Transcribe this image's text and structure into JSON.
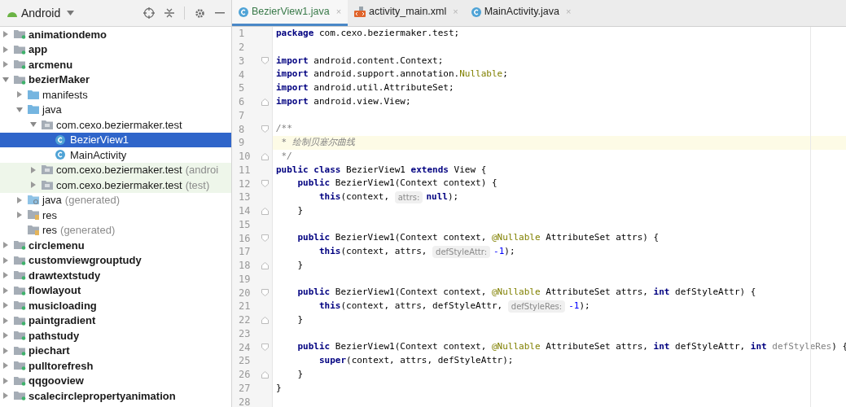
{
  "project_panel": {
    "title": "Android",
    "tree": [
      {
        "label": "animationdemo",
        "kind": "module",
        "expanded": false
      },
      {
        "label": "app",
        "kind": "module",
        "expanded": false
      },
      {
        "label": "arcmenu",
        "kind": "module",
        "expanded": false
      },
      {
        "label": "bezierMaker",
        "kind": "module",
        "expanded": true,
        "children": [
          {
            "label": "manifests",
            "kind": "folder",
            "expanded": false
          },
          {
            "label": "java",
            "kind": "folder",
            "expanded": true,
            "children": [
              {
                "label": "com.cexo.beziermaker.test",
                "kind": "package",
                "expanded": true,
                "children": [
                  {
                    "label": "BezierView1",
                    "kind": "class",
                    "selected": true
                  },
                  {
                    "label": "MainActivity",
                    "kind": "class",
                    "selected": false
                  }
                ]
              },
              {
                "label": "com.cexo.beziermaker.test",
                "suffix": "(androi",
                "kind": "package",
                "expanded": false,
                "tinted": true
              },
              {
                "label": "com.cexo.beziermaker.test",
                "suffix": "(test)",
                "kind": "package",
                "expanded": false,
                "tinted": true
              }
            ]
          },
          {
            "label": "java",
            "suffix": "(generated)",
            "kind": "generated",
            "expanded": false
          },
          {
            "label": "res",
            "kind": "res",
            "expanded": false
          },
          {
            "label": "res",
            "suffix": "(generated)",
            "kind": "res"
          }
        ]
      },
      {
        "label": "circlemenu",
        "kind": "module",
        "expanded": false
      },
      {
        "label": "customviewgrouptudy",
        "kind": "module",
        "expanded": false
      },
      {
        "label": "drawtextstudy",
        "kind": "module",
        "expanded": false
      },
      {
        "label": "flowlayout",
        "kind": "module",
        "expanded": false
      },
      {
        "label": "musicloading",
        "kind": "module",
        "expanded": false
      },
      {
        "label": "paintgradient",
        "kind": "module",
        "expanded": false
      },
      {
        "label": "pathstudy",
        "kind": "module",
        "expanded": false
      },
      {
        "label": "piechart",
        "kind": "module",
        "expanded": false
      },
      {
        "label": "pulltorefresh",
        "kind": "module",
        "expanded": false
      },
      {
        "label": "qqgooview",
        "kind": "module",
        "expanded": false
      },
      {
        "label": "scalecirclepropertyanimation",
        "kind": "module",
        "expanded": false
      }
    ]
  },
  "tabs": [
    {
      "label": "BezierView1.java",
      "kind": "class",
      "selected": true,
      "close": "×"
    },
    {
      "label": "activity_main.xml",
      "kind": "xml",
      "selected": false,
      "close": "×"
    },
    {
      "label": "MainActivity.java",
      "kind": "class",
      "selected": false,
      "close": "×"
    }
  ],
  "editor": {
    "lines": [
      {
        "number": "1",
        "fold_start": false,
        "fold_end": false,
        "current": false,
        "tokens": [
          {
            "kind": "kw",
            "text": "package"
          },
          {
            "kind": "plain",
            "text": " com.cexo.beziermaker.test;"
          }
        ]
      },
      {
        "number": "2",
        "fold_start": false,
        "fold_end": false,
        "current": false
      },
      {
        "number": "3",
        "fold_start": true,
        "fold_end": false,
        "current": false,
        "tokens": [
          {
            "kind": "kw",
            "text": "import"
          },
          {
            "kind": "plain",
            "text": " android.content.Context;"
          }
        ]
      },
      {
        "number": "4",
        "fold_start": false,
        "fold_end": false,
        "current": false,
        "tokens": [
          {
            "kind": "kw",
            "text": "import"
          },
          {
            "kind": "plain",
            "text": " android.support.annotation."
          },
          {
            "kind": "ann",
            "text": "Nullable"
          },
          {
            "kind": "plain",
            "text": ";"
          }
        ]
      },
      {
        "number": "5",
        "fold_start": false,
        "fold_end": false,
        "current": false,
        "tokens": [
          {
            "kind": "kw",
            "text": "import"
          },
          {
            "kind": "plain",
            "text": " android.util.AttributeSet;"
          }
        ]
      },
      {
        "number": "6",
        "fold_start": false,
        "fold_end": true,
        "current": false,
        "tokens": [
          {
            "kind": "kw",
            "text": "import"
          },
          {
            "kind": "plain",
            "text": " android.view.View;"
          }
        ]
      },
      {
        "number": "7",
        "fold_start": false,
        "fold_end": false,
        "current": false
      },
      {
        "number": "8",
        "fold_start": true,
        "fold_end": false,
        "current": false,
        "tokens": [
          {
            "kind": "comment",
            "text": "/**"
          }
        ]
      },
      {
        "number": "9",
        "fold_start": false,
        "fold_end": false,
        "current": true,
        "tokens": [
          {
            "kind": "comment",
            "text": " * 绘制贝塞尔曲线"
          }
        ]
      },
      {
        "number": "10",
        "fold_start": false,
        "fold_end": true,
        "current": false,
        "tokens": [
          {
            "kind": "comment",
            "text": " */"
          }
        ]
      },
      {
        "number": "11",
        "fold_start": false,
        "fold_end": false,
        "current": false,
        "tokens": [
          {
            "kind": "kw",
            "text": "public class"
          },
          {
            "kind": "plain",
            "text": " BezierView1 "
          },
          {
            "kind": "kw",
            "text": "extends"
          },
          {
            "kind": "plain",
            "text": " View {"
          }
        ]
      },
      {
        "number": "12",
        "fold_start": true,
        "fold_end": false,
        "current": false,
        "tokens": [
          {
            "kind": "kw",
            "text": "    public"
          },
          {
            "kind": "plain",
            "text": " BezierView1(Context context) {"
          }
        ]
      },
      {
        "number": "13",
        "fold_start": false,
        "fold_end": false,
        "current": false,
        "tokens": [
          {
            "kind": "kw",
            "text": "        this"
          },
          {
            "kind": "plain",
            "text": "(context, "
          },
          {
            "kind": "hint",
            "text": "attrs:"
          },
          {
            "kind": "kw",
            "text": "null"
          },
          {
            "kind": "plain",
            "text": ");"
          }
        ]
      },
      {
        "number": "14",
        "fold_start": false,
        "fold_end": true,
        "current": false,
        "tokens": [
          {
            "kind": "plain",
            "text": "    }"
          }
        ]
      },
      {
        "number": "15",
        "fold_start": false,
        "fold_end": false,
        "current": false
      },
      {
        "number": "16",
        "fold_start": true,
        "fold_end": false,
        "current": false,
        "tokens": [
          {
            "kind": "kw",
            "text": "    public"
          },
          {
            "kind": "plain",
            "text": " BezierView1(Context context, "
          },
          {
            "kind": "ann",
            "text": "@Nullable"
          },
          {
            "kind": "plain",
            "text": " AttributeSet attrs) {"
          }
        ]
      },
      {
        "number": "17",
        "fold_start": false,
        "fold_end": false,
        "current": false,
        "tokens": [
          {
            "kind": "kw",
            "text": "        this"
          },
          {
            "kind": "plain",
            "text": "(context, attrs, "
          },
          {
            "kind": "hint",
            "text": "defStyleAttr:"
          },
          {
            "kind": "num",
            "text": "-1"
          },
          {
            "kind": "plain",
            "text": ");"
          }
        ]
      },
      {
        "number": "18",
        "fold_start": false,
        "fold_end": true,
        "current": false,
        "tokens": [
          {
            "kind": "plain",
            "text": "    }"
          }
        ]
      },
      {
        "number": "19",
        "fold_start": false,
        "fold_end": false,
        "current": false
      },
      {
        "number": "20",
        "fold_start": true,
        "fold_end": false,
        "current": false,
        "tokens": [
          {
            "kind": "kw",
            "text": "    public"
          },
          {
            "kind": "plain",
            "text": " BezierView1(Context context, "
          },
          {
            "kind": "ann",
            "text": "@Nullable"
          },
          {
            "kind": "plain",
            "text": " AttributeSet attrs, "
          },
          {
            "kind": "kw",
            "text": "int"
          },
          {
            "kind": "plain",
            "text": " defStyleAttr) {"
          }
        ]
      },
      {
        "number": "21",
        "fold_start": false,
        "fold_end": false,
        "current": false,
        "tokens": [
          {
            "kind": "kw",
            "text": "        this"
          },
          {
            "kind": "plain",
            "text": "(context, attrs, defStyleAttr, "
          },
          {
            "kind": "hint",
            "text": "defStyleRes:"
          },
          {
            "kind": "num",
            "text": "-1"
          },
          {
            "kind": "plain",
            "text": ");"
          }
        ]
      },
      {
        "number": "22",
        "fold_start": false,
        "fold_end": true,
        "current": false,
        "tokens": [
          {
            "kind": "plain",
            "text": "    }"
          }
        ]
      },
      {
        "number": "23",
        "fold_start": false,
        "fold_end": false,
        "current": false
      },
      {
        "number": "24",
        "fold_start": true,
        "fold_end": false,
        "current": false,
        "tokens": [
          {
            "kind": "kw",
            "text": "    public"
          },
          {
            "kind": "plain",
            "text": " BezierView1(Context context, "
          },
          {
            "kind": "ann",
            "text": "@Nullable"
          },
          {
            "kind": "plain",
            "text": " AttributeSet attrs, "
          },
          {
            "kind": "kw",
            "text": "int"
          },
          {
            "kind": "plain",
            "text": " defStyleAttr, "
          },
          {
            "kind": "kw",
            "text": "int"
          },
          {
            "kind": "unused",
            "text": " defStyleRes"
          },
          {
            "kind": "plain",
            "text": ") {"
          }
        ]
      },
      {
        "number": "25",
        "fold_start": false,
        "fold_end": false,
        "current": false,
        "tokens": [
          {
            "kind": "kw",
            "text": "        super"
          },
          {
            "kind": "plain",
            "text": "(context, attrs, defStyleAttr);"
          }
        ]
      },
      {
        "number": "26",
        "fold_start": false,
        "fold_end": true,
        "current": false,
        "tokens": [
          {
            "kind": "plain",
            "text": "    }"
          }
        ]
      },
      {
        "number": "27",
        "fold_start": false,
        "fold_end": false,
        "current": false,
        "tokens": [
          {
            "kind": "plain",
            "text": "}"
          }
        ]
      },
      {
        "number": "28",
        "fold_start": false,
        "fold_end": false,
        "current": false
      }
    ]
  }
}
